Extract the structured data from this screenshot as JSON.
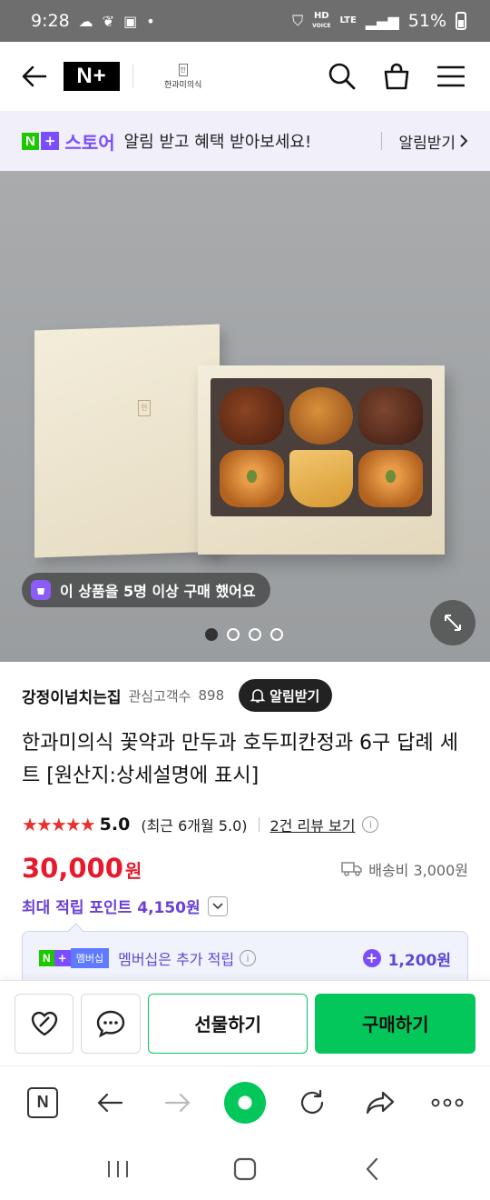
{
  "status_bar": {
    "time": "9:28",
    "notif_icons": [
      "cloud-icon",
      "wing-icon",
      "image-icon",
      "dot-icon"
    ],
    "hd_label": "HD",
    "voice_label": "VOICE",
    "lte_label": "LTE",
    "battery": "51%"
  },
  "appbar": {
    "logo": "N+",
    "shop_seal": "한",
    "shop_name": "한과미의식"
  },
  "store_banner": {
    "badge_n": "N",
    "badge_plus": "+",
    "badge_word": "스토어",
    "message": "알림 받고 혜택 받아보세요!",
    "link": "알림받기"
  },
  "hero": {
    "lid_emblem": "한",
    "buyer_notice": "이 상품을 5명 이상 구매 했어요",
    "slide_count": 4,
    "active_slide": 1
  },
  "seller": {
    "name": "강정이넘치는집",
    "fans_label": "관심고객수",
    "fans_count": "898",
    "alert_button": "알림받기"
  },
  "product": {
    "title": "한과미의식 꽃약과 만두과 호두피칸정과 6구 답례 세트 [원산지:상세설명에 표시]",
    "stars": "★★★★★",
    "rating": "5.0",
    "recent_rating": "(최근 6개월 5.0)",
    "reviews_link": "2건 리뷰 보기",
    "price": "30,000",
    "currency": "원",
    "shipping": "배송비 3,000원",
    "max_points": "최대 적립 포인트 4,150원"
  },
  "membership": {
    "badge_n": "N",
    "badge_plus": "+",
    "badge_text": "멤버십",
    "text": "멤버십은 추가 적립",
    "points": "1,200원"
  },
  "buy_bar": {
    "gift_label": "선물하기",
    "buy_label": "구매하기"
  },
  "browser_bar": {
    "home_label": "N"
  },
  "colors": {
    "accent_green": "#03c75a",
    "price_red": "#e8192c",
    "purple": "#7a4dff",
    "star_red": "#e8312e"
  }
}
